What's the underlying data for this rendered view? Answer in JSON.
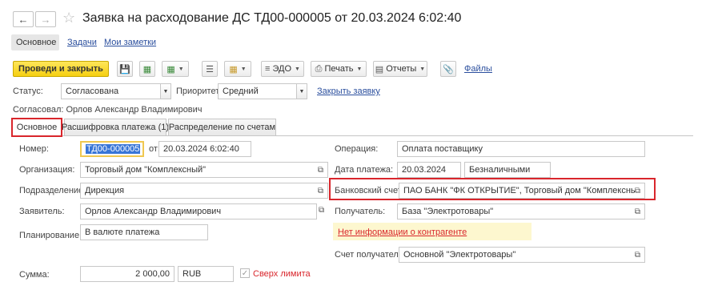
{
  "window": {
    "back_icon": "arrow-left-icon",
    "forward_icon": "arrow-right-icon",
    "star_icon": "star-icon",
    "title": "Заявка на расходование ДС ТД00-000005 от 20.03.2024 6:02:40"
  },
  "top_tabs": [
    "Основное",
    "Задачи",
    "Мои заметки"
  ],
  "toolbar": {
    "post_close": "Проведи и закрыть",
    "edo": "ЭДО",
    "print": "Печать",
    "reports": "Отчеты",
    "files": "Файлы"
  },
  "status_row": {
    "status_label": "Статус:",
    "status_value": "Согласована",
    "priority_label": "Приоритет:",
    "priority_value": "Средний",
    "link": "Закрыть заявку"
  },
  "approved": "Согласовал: Орлов Александр Владимирович",
  "form_tabs": [
    "Основное",
    "Расшифровка платежа (1)",
    "Распределение по счетам"
  ],
  "form": {
    "number_label": "Номер:",
    "number_value": "ТД00-000005",
    "date_from_label": "от:",
    "date_value": "20.03.2024  6:02:40",
    "org_label": "Организация:",
    "org_value": "Торговый дом \"Комплексный\"",
    "dept_label": "Подразделение:",
    "dept_value": "Дирекция",
    "applicant_label": "Заявитель:",
    "applicant_value": "Орлов Александр Владимирович",
    "planning_label": "Планирование:",
    "planning_value": "В валюте платежа",
    "sum_label": "Сумма:",
    "sum_value": "2 000,00",
    "currency_value": "RUB",
    "over_limit": "Сверх лимита",
    "operation_label": "Операция:",
    "operation_value": "Оплата поставщику",
    "pay_date_label": "Дата платежа:",
    "pay_date_value": "20.03.2024",
    "pay_type_value": "Безналичными",
    "bank_label": "Банковский счет:",
    "bank_value": "ПАО БАНК \"ФК ОТКРЫТИЕ\", Торговый дом \"Комплексный\" (RU",
    "recipient_label": "Получатель:",
    "recipient_value": "База \"Электротовары\"",
    "no_info": "Нет информации о контрагенте",
    "recipient_acc_label": "Счет получателя:",
    "recipient_acc_value": "Основной \"Электротовары\""
  }
}
